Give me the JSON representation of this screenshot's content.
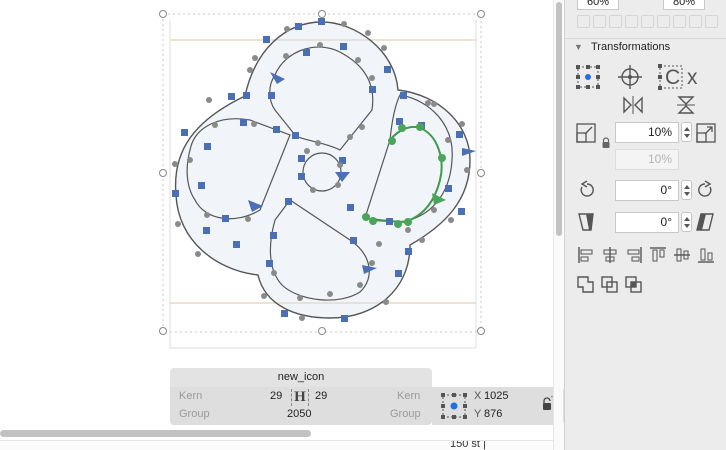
{
  "glyph": {
    "name": "new_icon",
    "left_kern_label": "Kern",
    "left_metric": "29",
    "right_metric": "29",
    "right_kern_label": "Kern",
    "left_group_label": "Group",
    "width": "2050",
    "right_group_label": "Group",
    "h_symbol": "H"
  },
  "coords": {
    "x_label": "X",
    "x_value": "1025",
    "y_label": "Y",
    "y_value": "876"
  },
  "panel": {
    "top_fields": [
      "60%",
      "80%"
    ],
    "transformations_label": "Transformations",
    "scale_value": "10%",
    "scale_value_secondary": "10%",
    "rotate_value": "0°",
    "slant_value": "0°"
  },
  "status": {
    "bottom_text": "150 st  |"
  },
  "colors": {
    "node_square": "#4a6fb5",
    "node_round_selected": "#4aa55a",
    "handle": "#8a8a8a",
    "outline": "#555555",
    "fill_hint": "#d7e3f0"
  }
}
